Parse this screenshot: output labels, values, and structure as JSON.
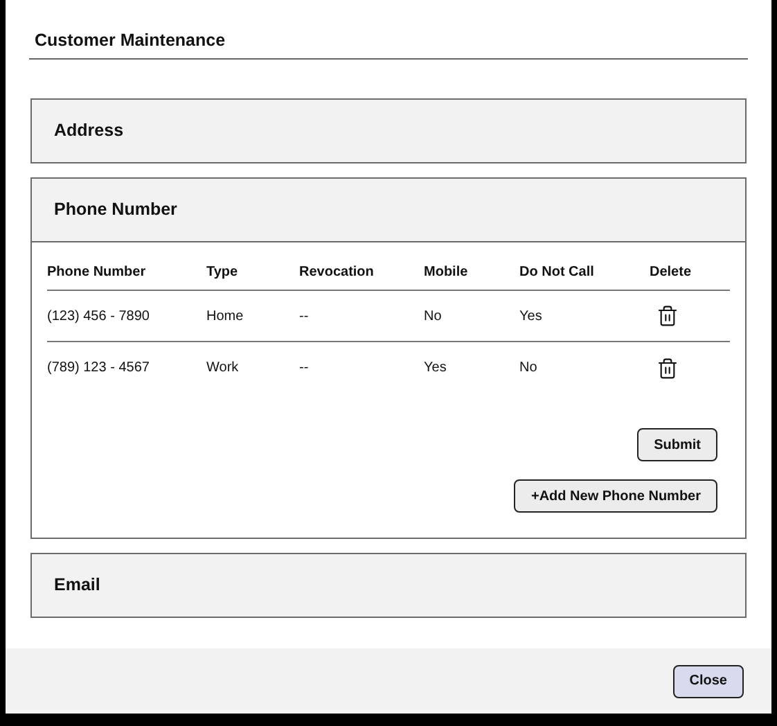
{
  "dialog": {
    "title": "Customer Maintenance"
  },
  "sections": [
    {
      "title": "Address",
      "expanded": false
    },
    {
      "title": "Phone Number",
      "expanded": true,
      "table": {
        "columns": [
          "Phone Number",
          "Type",
          "Revocation",
          "Mobile",
          "Do Not Call",
          "Delete"
        ],
        "rows": [
          {
            "phone": "(123) 456 - 7890",
            "type": "Home",
            "revocation": "--",
            "mobile": "No",
            "do_not_call": "Yes"
          },
          {
            "phone": "(789) 123 - 4567",
            "type": "Work",
            "revocation": "--",
            "mobile": "Yes",
            "do_not_call": "No"
          }
        ]
      },
      "buttons": [
        "Submit",
        "+Add New Phone Number"
      ]
    },
    {
      "title": "Email",
      "expanded": false
    }
  ],
  "footer": {
    "buttons": [
      "Close"
    ]
  }
}
